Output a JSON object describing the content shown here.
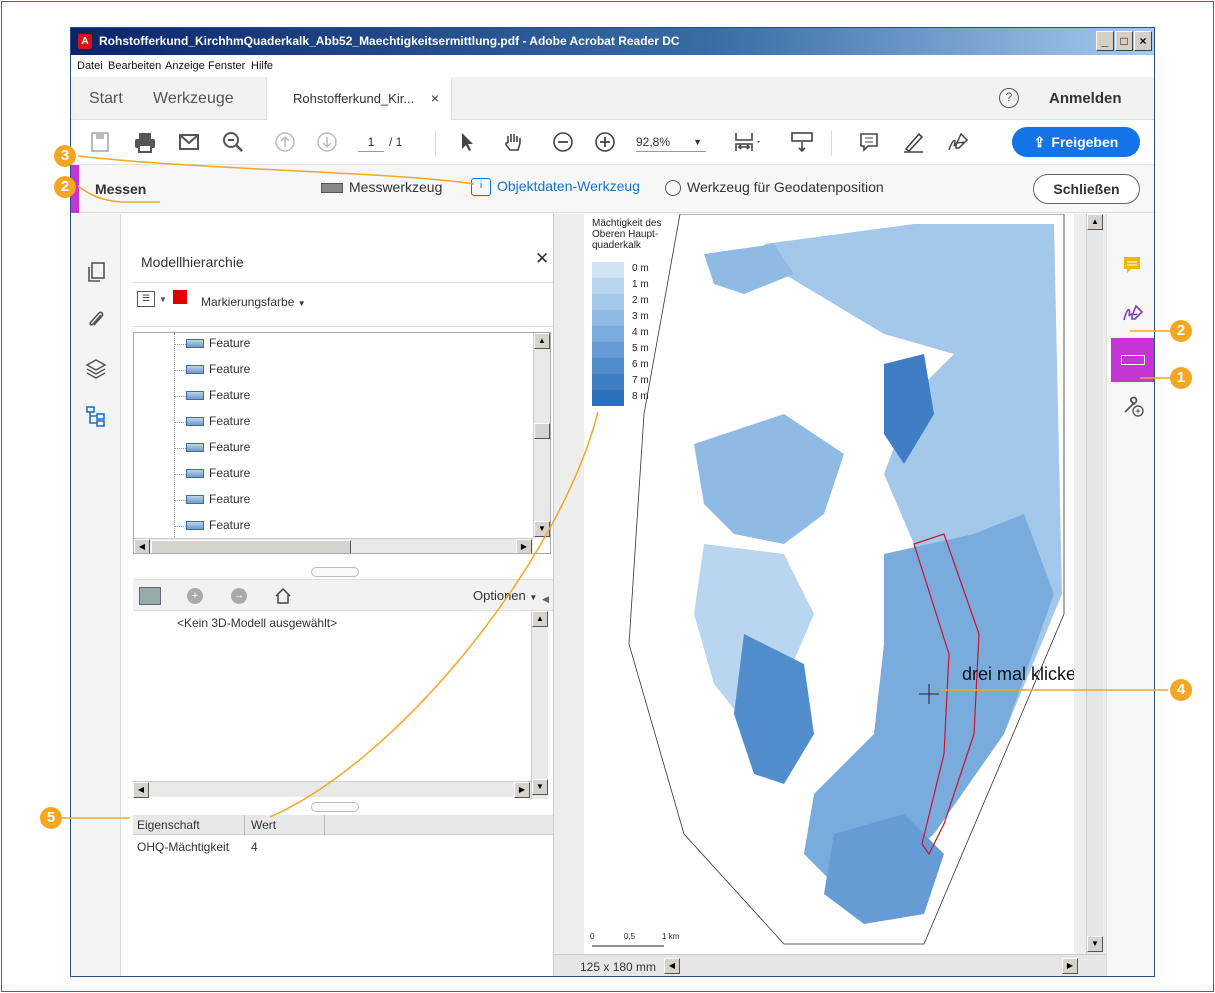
{
  "window": {
    "title": "Rohstofferkund_KirchhmQuaderkalk_Abb52_Maechtigkeitsermittlung.pdf - Adobe Acrobat Reader DC",
    "app_icon_glyph": "A",
    "controls": [
      "_",
      "□",
      "×"
    ]
  },
  "menu": [
    "Datei",
    "Bearbeiten",
    "Anzeige",
    "Fenster",
    "Hilfe"
  ],
  "tabs": {
    "start": "Start",
    "werkzeuge": "Werkzeuge",
    "document": "Rohstofferkund_Kir...",
    "close_glyph": "×",
    "help_glyph": "?",
    "anmelden": "Anmelden"
  },
  "toolbar": {
    "page_current": "1",
    "page_total": "/ 1",
    "zoom": "92,8%",
    "freigeben": "Freigeben",
    "icons": [
      "save-icon",
      "print-icon",
      "mail-icon",
      "zoom-search-icon",
      "page-up-icon",
      "page-down-icon",
      "select-cursor-icon",
      "hand-icon",
      "zoom-out-icon",
      "zoom-in-icon",
      "fit-page-icon",
      "scroll-mode-icon",
      "comment-icon",
      "highlight-pen-icon",
      "sign-icon"
    ]
  },
  "messen_bar": {
    "title": "Messen",
    "messwerkzeug": "Messwerkzeug",
    "objektdaten": "Objektdaten-Werkzeug",
    "geodaten": "Werkzeug für Geodatenposition",
    "schliessen": "Schließen"
  },
  "panel": {
    "title": "Modellhierarchie",
    "close_glyph": "✕",
    "markierungsfarbe": "Markierungsfarbe",
    "marker_color": "#e00000",
    "features": [
      "Feature",
      "Feature",
      "Feature",
      "Feature",
      "Feature",
      "Feature",
      "Feature",
      "Feature"
    ],
    "optionen": "Optionen",
    "no_model": "<Kein 3D-Modell ausgewählt>",
    "prop_header_name": "Eigenschaft",
    "prop_header_value": "Wert",
    "prop_name": "OHQ-Mächtigkeit",
    "prop_value": "4"
  },
  "map": {
    "legend_title_1": "Mächtigkeit des",
    "legend_title_2": "Oberen Haupt-",
    "legend_title_3": "quaderkalk",
    "legend": [
      {
        "label": "0 m",
        "color": "#cfe4f5"
      },
      {
        "label": "1 m",
        "color": "#b9d6f0"
      },
      {
        "label": "2 m",
        "color": "#a4c8ea"
      },
      {
        "label": "3 m",
        "color": "#8fbae4"
      },
      {
        "label": "4 m",
        "color": "#7aabdd"
      },
      {
        "label": "5 m",
        "color": "#659cd5"
      },
      {
        "label": "6 m",
        "color": "#518dcd"
      },
      {
        "label": "7 m",
        "color": "#3f7ec4"
      },
      {
        "label": "8 m",
        "color": "#2e6fba"
      }
    ],
    "scale_0": "0",
    "scale_05": "0,5",
    "scale_1": "1 km",
    "page_size": "125 x 180 mm",
    "click_hint": "drei mal klicken"
  },
  "callouts": {
    "c1": "1",
    "c2": "2",
    "c3": "3",
    "c4": "4",
    "c5": "5"
  },
  "colors": {
    "accent_purple": "#c435d4",
    "callout_orange": "#f5a623",
    "share_blue": "#1473e6",
    "outline_red": "#cc1133"
  }
}
